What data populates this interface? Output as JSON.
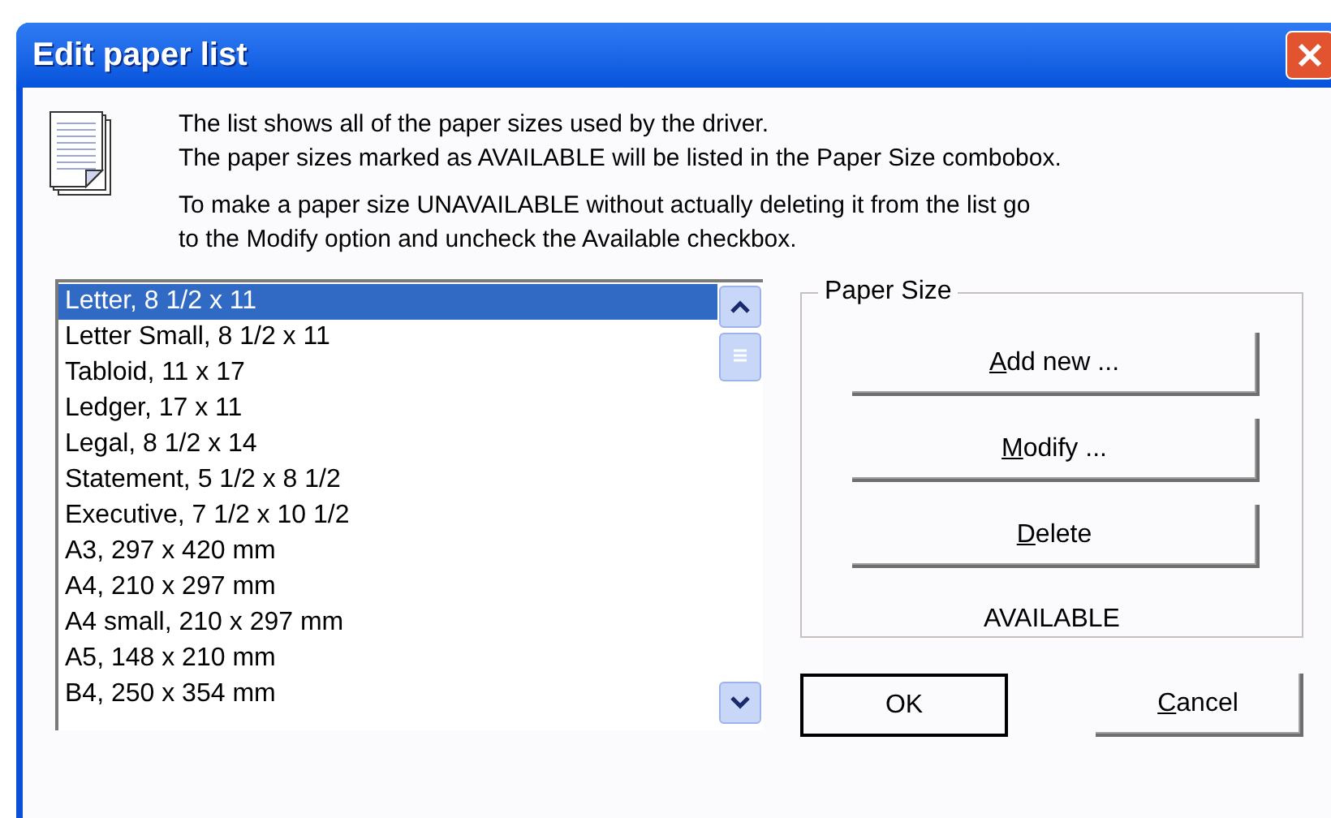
{
  "window": {
    "title": "Edit paper list"
  },
  "info": {
    "lines_top": [
      "The list shows all of the paper sizes used by the driver.",
      "The paper sizes marked as AVAILABLE will be listed in the Paper Size combobox."
    ],
    "lines_bottom": [
      "To make a paper size UNAVAILABLE without actually deleting it from the list go",
      "to the Modify option and uncheck the Available checkbox."
    ]
  },
  "paper_list": [
    {
      "label": "Letter, 8 1/2 x 11",
      "selected": true
    },
    {
      "label": "Letter Small, 8 1/2 x 11",
      "selected": false
    },
    {
      "label": "Tabloid, 11 x 17",
      "selected": false
    },
    {
      "label": "Ledger, 17 x 11",
      "selected": false
    },
    {
      "label": "Legal, 8 1/2 x 14",
      "selected": false
    },
    {
      "label": "Statement, 5 1/2 x 8 1/2",
      "selected": false
    },
    {
      "label": "Executive, 7 1/2 x 10 1/2",
      "selected": false
    },
    {
      "label": "A3, 297 x 420 mm",
      "selected": false
    },
    {
      "label": "A4, 210 x 297 mm",
      "selected": false
    },
    {
      "label": "A4 small, 210 x 297 mm",
      "selected": false
    },
    {
      "label": "A5, 148 x 210 mm",
      "selected": false
    },
    {
      "label": "B4, 250 x 354 mm",
      "selected": false
    }
  ],
  "paper_size_group": {
    "title": "Paper Size",
    "buttons": [
      {
        "accel": "A",
        "rest": "dd new ..."
      },
      {
        "accel": "M",
        "rest": "odify ..."
      },
      {
        "accel": "D",
        "rest": "elete"
      }
    ],
    "status": "AVAILABLE"
  },
  "footer_buttons": [
    {
      "rest": "OK",
      "default": true
    },
    {
      "accel": "C",
      "rest": "ancel",
      "default": false
    }
  ]
}
